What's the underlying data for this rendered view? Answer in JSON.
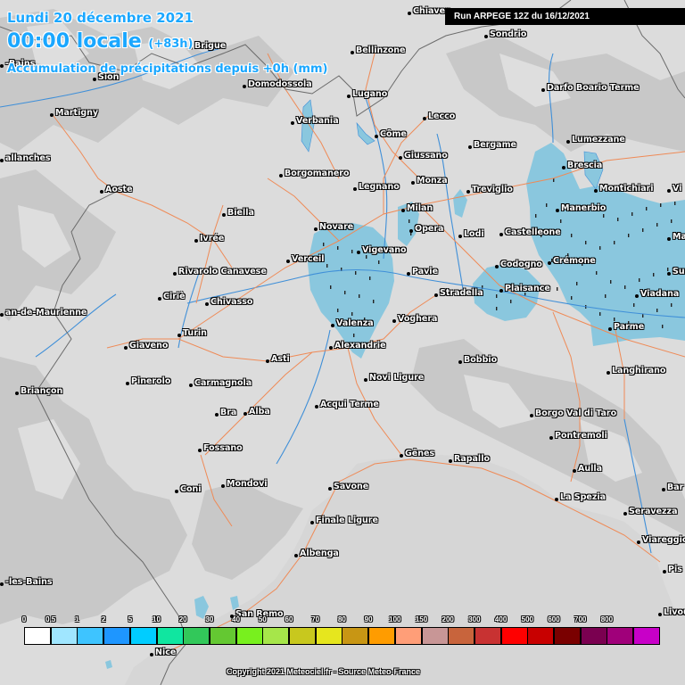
{
  "header": {
    "date_line": "Lundi 20 décembre 2021",
    "time_main": "00:00 locale",
    "time_offset": "(+83h)",
    "product": "Accumulation de précipitations depuis +0h (mm)"
  },
  "run_label": "Run ARPEGE 12Z du 16/12/2021",
  "copyright": "Copyright 2021 Meteociel.fr - Source Meteo-France",
  "colors": {
    "sea": "#d6d6d6",
    "land": "#dcdcdc",
    "precip": "#8ac7de",
    "rivers": "#3f8fd8",
    "roads": "#ef8a56",
    "borders": "#6a6a6a",
    "header_text": "#1aa7ff"
  },
  "cities": [
    {
      "name": "Chiavenna",
      "label": "Chiaven"
    },
    {
      "name": "Sondrio",
      "label": "Sondrio"
    },
    {
      "name": "Brigue",
      "label": "Brigue"
    },
    {
      "name": "Bellinzone",
      "label": "Bellinzone"
    },
    {
      "name": "Aix-les-Bains",
      "label": "-Bains"
    },
    {
      "name": "Sion",
      "label": "Sion"
    },
    {
      "name": "Domodossola",
      "label": "Domodossola"
    },
    {
      "name": "Darfo Boario Terme",
      "label": "Darfo Boario Terme"
    },
    {
      "name": "Lugano",
      "label": "Lugano"
    },
    {
      "name": "Martigny",
      "label": "Martigny"
    },
    {
      "name": "Verbania",
      "label": "Verbania"
    },
    {
      "name": "Lecco",
      "label": "Lecco"
    },
    {
      "name": "Côme",
      "label": "Côme"
    },
    {
      "name": "Lumezzane",
      "label": "Lumezzane"
    },
    {
      "name": "Bergame",
      "label": "Bergame"
    },
    {
      "name": "Giussano",
      "label": "Giussano"
    },
    {
      "name": "Sallanches",
      "label": "allanches"
    },
    {
      "name": "Brescia",
      "label": "Brescia"
    },
    {
      "name": "Borgomanero",
      "label": "Borgomanero"
    },
    {
      "name": "Monza",
      "label": "Monza"
    },
    {
      "name": "Montichiari",
      "label": "Montichiari"
    },
    {
      "name": "Aoste",
      "label": "Aoste"
    },
    {
      "name": "Legnano",
      "label": "Legnano"
    },
    {
      "name": "Treviglio",
      "label": "Treviglio"
    },
    {
      "name": "Milan",
      "label": "Milan"
    },
    {
      "name": "Manerbio",
      "label": "Manerbio"
    },
    {
      "name": "Biella",
      "label": "Biella"
    },
    {
      "name": "Novare",
      "label": "Novare"
    },
    {
      "name": "Opera",
      "label": "Opera"
    },
    {
      "name": "Castelleone",
      "label": "Castelleone"
    },
    {
      "name": "Lodi",
      "label": "Lodi"
    },
    {
      "name": "Ivrée",
      "label": "Ivrée"
    },
    {
      "name": "Vigevano",
      "label": "Vigevano"
    },
    {
      "name": "Verceil",
      "label": "Verceil"
    },
    {
      "name": "Codogno",
      "label": "Codogno"
    },
    {
      "name": "Crémone",
      "label": "Crémone"
    },
    {
      "name": "Pavie",
      "label": "Pavie"
    },
    {
      "name": "Rivarolo Canavese",
      "label": "Rivarolo Canavese"
    },
    {
      "name": "Plaisance",
      "label": "Plaisance"
    },
    {
      "name": "Stradella",
      "label": "Stradella"
    },
    {
      "name": "Viadana",
      "label": "Viadana"
    },
    {
      "name": "Ciriè",
      "label": "Ciriè"
    },
    {
      "name": "Chivasso",
      "label": "Chivasso"
    },
    {
      "name": "Saint-Jean-de-Maurienne",
      "label": "an-de-Maurienne"
    },
    {
      "name": "Voghera",
      "label": "Voghera"
    },
    {
      "name": "Valenza",
      "label": "Valenza"
    },
    {
      "name": "Parme",
      "label": "Parme"
    },
    {
      "name": "Turin",
      "label": "Turin"
    },
    {
      "name": "Giaveno",
      "label": "Giaveno"
    },
    {
      "name": "Alexandrie",
      "label": "Alexandrie"
    },
    {
      "name": "Asti",
      "label": "Asti"
    },
    {
      "name": "Bobbio",
      "label": "Bobbio"
    },
    {
      "name": "Langhirano",
      "label": "Langhirano"
    },
    {
      "name": "Pinerolo",
      "label": "Pinerolo"
    },
    {
      "name": "Carmagnola",
      "label": "Carmagnola"
    },
    {
      "name": "Novi Ligure",
      "label": "Novi Ligure"
    },
    {
      "name": "Briançon",
      "label": "Briançon"
    },
    {
      "name": "Acqui Terme",
      "label": "Acqui Terme"
    },
    {
      "name": "Bra",
      "label": "Bra"
    },
    {
      "name": "Alba",
      "label": "Alba"
    },
    {
      "name": "Borgo Val di Taro",
      "label": "Borgo Val di Taro"
    },
    {
      "name": "Pontremoli",
      "label": "Pontremoli"
    },
    {
      "name": "Fossano",
      "label": "Fossano"
    },
    {
      "name": "Gênes",
      "label": "Gênes"
    },
    {
      "name": "Rapallo",
      "label": "Rapallo"
    },
    {
      "name": "Aulla",
      "label": "Aulla"
    },
    {
      "name": "Coni",
      "label": "Coni"
    },
    {
      "name": "Mondovi",
      "label": "Mondovi"
    },
    {
      "name": "Savone",
      "label": "Savone"
    },
    {
      "name": "La Spezia",
      "label": "La Spezia"
    },
    {
      "name": "Seravezza",
      "label": "Seravezza"
    },
    {
      "name": "Finale Ligure",
      "label": "Finale Ligure"
    },
    {
      "name": "Viareggio",
      "label": "Viareggio"
    },
    {
      "name": "Albenga",
      "label": "Albenga"
    },
    {
      "name": "Aix-les-Bains-sud",
      "label": "-les-Bains"
    },
    {
      "name": "San Remo",
      "label": "San Remo"
    },
    {
      "name": "Nice",
      "label": "Nice"
    },
    {
      "name": "Livourne",
      "label": "Livou"
    },
    {
      "name": "Pise",
      "label": "Pis"
    },
    {
      "name": "Barga",
      "label": "Bar"
    },
    {
      "name": "Vicence",
      "label": "Vi"
    },
    {
      "name": "Mantoue",
      "label": "Ma"
    },
    {
      "name": "Suzzara",
      "label": "Su"
    }
  ],
  "legend": {
    "ticks": [
      "0",
      "0.5",
      "1",
      "2",
      "5",
      "10",
      "20",
      "30",
      "40",
      "50",
      "60",
      "70",
      "80",
      "90",
      "100",
      "150",
      "200",
      "300",
      "400",
      "500",
      "600",
      "700",
      "800"
    ],
    "colors": [
      "#ffffff",
      "#a0e6ff",
      "#3ec4ff",
      "#1e96ff",
      "#00cdff",
      "#10e6a0",
      "#32c85a",
      "#64c832",
      "#78f01e",
      "#a6e64a",
      "#c8c81e",
      "#e6e61e",
      "#c89614",
      "#ff9c00",
      "#ff9e78",
      "#c89696",
      "#c8643c",
      "#c83232",
      "#ff0000",
      "#c80000",
      "#7a0000",
      "#7a0050",
      "#a0007a",
      "#c800c8"
    ]
  }
}
